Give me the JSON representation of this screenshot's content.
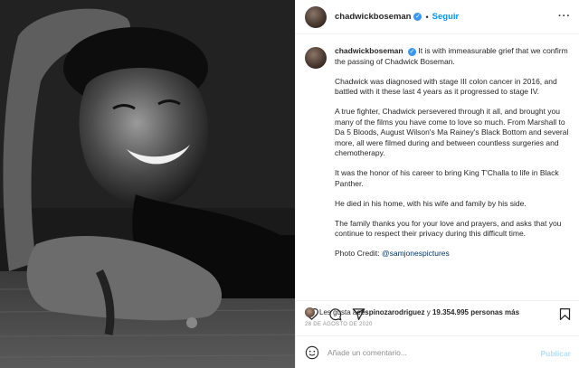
{
  "colors": {
    "link_blue": "#0095f6",
    "verified_blue": "#3897f0",
    "text": "#262626",
    "muted": "#8e8e8e",
    "publish_disabled": "#b2dffc",
    "divider": "#efefef"
  },
  "header": {
    "username": "chadwickboseman",
    "separator": "•",
    "follow_label": "Seguir",
    "more_icon": "more-options-icon"
  },
  "caption": {
    "username": "chadwickboseman",
    "paragraphs": [
      "It is with immeasurable grief that we confirm the passing of Chadwick Boseman.",
      "Chadwick was diagnosed with stage III colon cancer in 2016, and battled with it these last 4 years as it progressed to stage IV.",
      "A true fighter, Chadwick persevered through it all, and brought you many of the films you have come to love so much. From Marshall to Da 5 Bloods, August Wilson's Ma Rainey's Black Bottom and several more, all were filmed during and between countless surgeries and chemotherapy.",
      "It was the honor of his career to bring King T'Challa to life in Black Panther.",
      "He died in his home, with his wife and family by his side.",
      "The family thanks you for your love and prayers, and asks that you continue to respect their privacy during this difficult time."
    ],
    "credit_prefix": "Photo Credit: ",
    "credit_mention": "@samjonespictures"
  },
  "actions": {
    "icons": [
      "heart-icon",
      "comment-icon",
      "share-icon",
      "save-icon"
    ]
  },
  "likes": {
    "prefix": "Les gusta a ",
    "user": "eespinozarodriguez",
    "middle": " y ",
    "count": "19.354.995 personas más"
  },
  "date": "28 DE AGOSTO DE 2020",
  "comment": {
    "placeholder": "Añade un comentario...",
    "publish_label": "Publicar"
  }
}
